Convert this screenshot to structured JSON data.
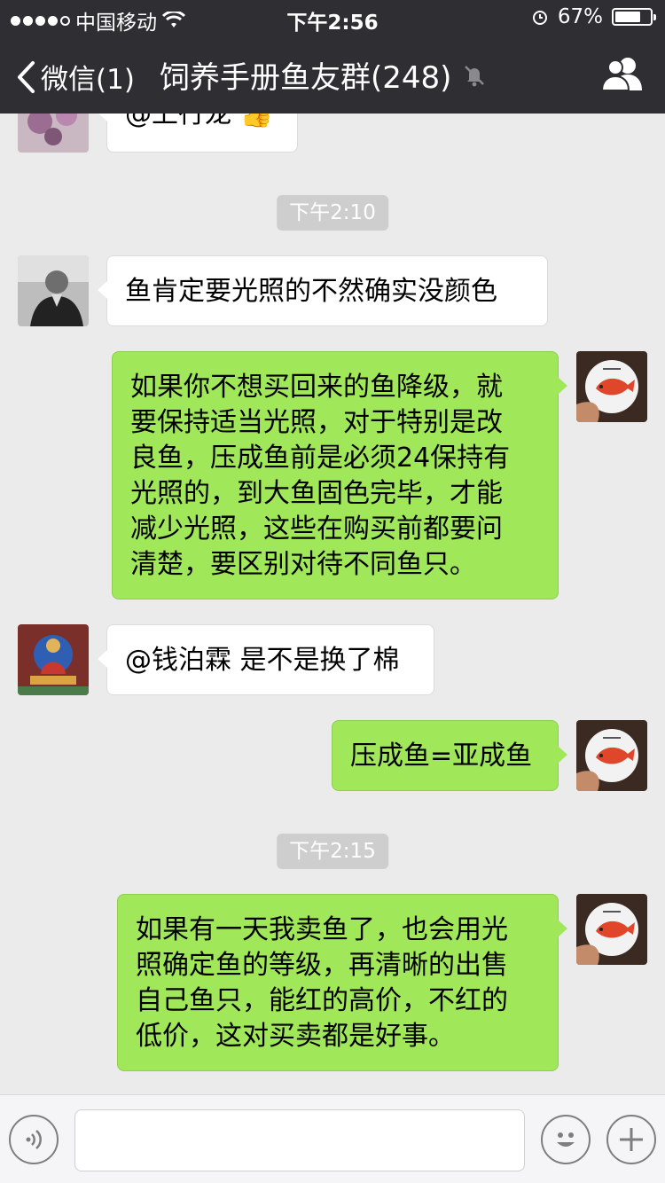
{
  "status_bar": {
    "carrier": "中国移动",
    "time": "下午2:56",
    "battery": "67%",
    "battery_level": 0.67
  },
  "nav": {
    "back_label": "微信(1)",
    "title": "饲养手册鱼友群(248)",
    "icons": [
      "chevron-left-icon",
      "mute-icon",
      "group-members-icon"
    ]
  },
  "messages": [
    {
      "side": "in",
      "text": "@上行龙 👍"
    },
    {
      "type": "time",
      "text": "下午2:10"
    },
    {
      "side": "in",
      "text": "鱼肯定要光照的不然确实没颜色"
    },
    {
      "side": "out",
      "text": "如果你不想买回来的鱼降级，就\n要保持适当光照，对于特别是改\n良鱼，压成鱼前是必须24保持有\n光照的，到大鱼固色完毕，才能\n减少光照，这些在购买前都要问\n清楚，要区别对待不同鱼只。"
    },
    {
      "side": "in",
      "text": "@钱泊霖 是不是换了棉"
    },
    {
      "side": "out",
      "text": "压成鱼=亚成鱼"
    },
    {
      "type": "time",
      "text": "下午2:15"
    },
    {
      "side": "out",
      "text": "如果有一天我卖鱼了，也会用光\n照确定鱼的等级，再清晰的出售\n自己鱼只，能红的高价，不红的\n低价，这对买卖都是好事。"
    }
  ],
  "input_bar": {
    "value": "",
    "icons": [
      "voice-icon",
      "emoji-icon",
      "plus-icon"
    ]
  },
  "colors": {
    "bar": "#2e2e33",
    "background": "#ebebeb",
    "outgoing_bubble": "#a0e75a",
    "incoming_bubble": "#ffffff"
  }
}
